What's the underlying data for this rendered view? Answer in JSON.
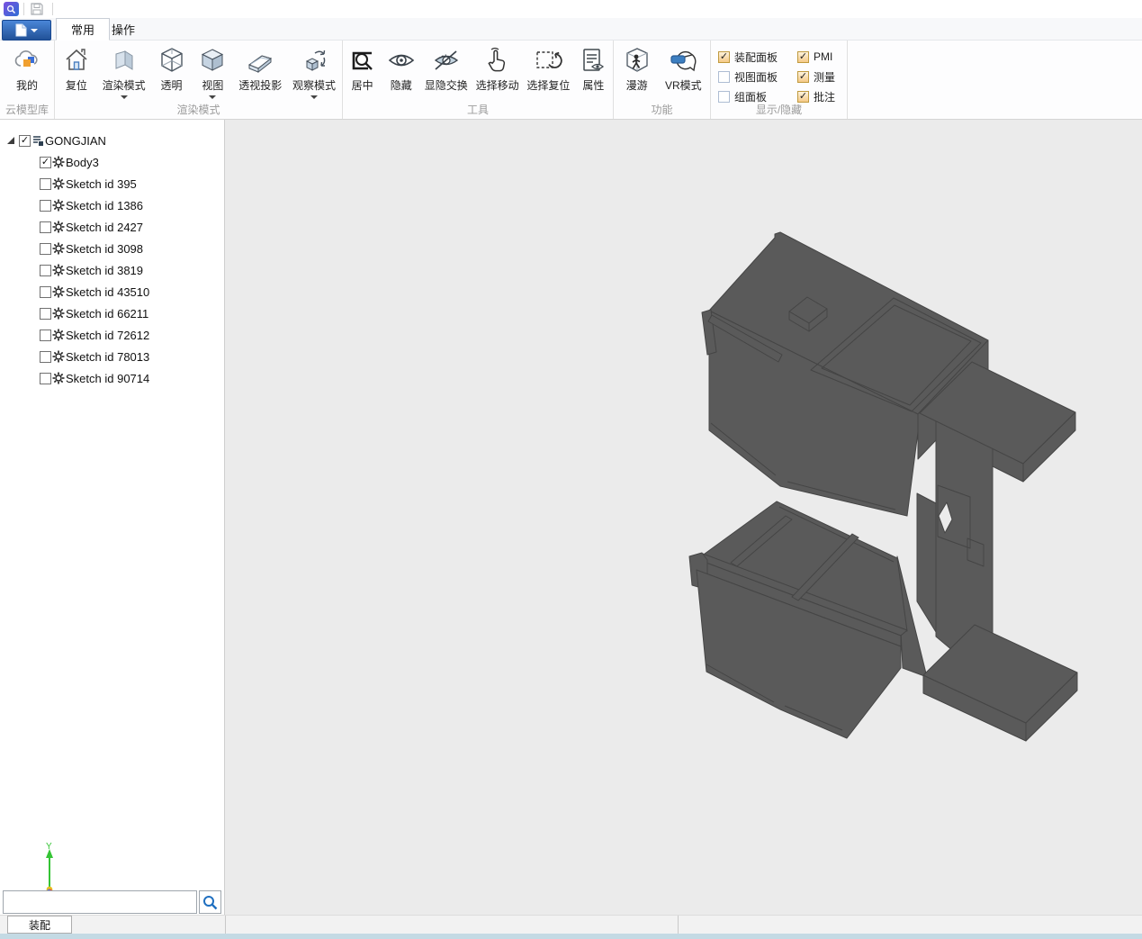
{
  "titlebar": {
    "app_icon": "magnifier-app-icon",
    "save_icon": "save-icon"
  },
  "tabs": {
    "file_button": "file-menu",
    "items": [
      {
        "label": "常用",
        "active": true
      },
      {
        "label": "操作",
        "active": false
      }
    ]
  },
  "ribbon": {
    "groups": [
      {
        "label": "云模型库",
        "buttons": [
          {
            "label": "我的",
            "icon": "cloud-cube"
          }
        ]
      },
      {
        "label": "渲染模式",
        "buttons": [
          {
            "label": "复位",
            "icon": "home"
          },
          {
            "label": "渲染模式",
            "icon": "shaded-face",
            "dropdown": true
          },
          {
            "label": "透明",
            "icon": "wireframe-cube"
          },
          {
            "label": "视图",
            "icon": "solid-cube",
            "dropdown": true
          },
          {
            "label": "透视投影",
            "icon": "perspective-box"
          },
          {
            "label": "观察模式",
            "icon": "orbit-cube",
            "dropdown": true
          }
        ]
      },
      {
        "label": "工具",
        "buttons": [
          {
            "label": "居中",
            "icon": "zoom-fit"
          },
          {
            "label": "隐藏",
            "icon": "eye"
          },
          {
            "label": "显隐交换",
            "icon": "eye-swap"
          },
          {
            "label": "选择移动",
            "icon": "hand-select"
          },
          {
            "label": "选择复位",
            "icon": "selection-reset"
          },
          {
            "label": "属性",
            "icon": "properties-doc"
          }
        ]
      },
      {
        "label": "功能",
        "buttons": [
          {
            "label": "漫游",
            "icon": "walk-cube"
          },
          {
            "label": "VR模式",
            "icon": "vr-headset"
          }
        ]
      },
      {
        "label": "显示/隐藏",
        "checkboxes": [
          {
            "label": "装配面板",
            "checked": true
          },
          {
            "label": "PMI",
            "checked": true
          },
          {
            "label": "视图面板",
            "checked": false
          },
          {
            "label": "测量",
            "checked": true
          },
          {
            "label": "组面板",
            "checked": false
          },
          {
            "label": "批注",
            "checked": true
          }
        ]
      }
    ]
  },
  "tree": {
    "root": {
      "label": "GONGJIAN",
      "checked": true,
      "expanded": true
    },
    "children": [
      {
        "label": "Body3",
        "checked": true
      },
      {
        "label": "Sketch id 395",
        "checked": false
      },
      {
        "label": "Sketch id 1386",
        "checked": false
      },
      {
        "label": "Sketch id 2427",
        "checked": false
      },
      {
        "label": "Sketch id 3098",
        "checked": false
      },
      {
        "label": "Sketch id 3819",
        "checked": false
      },
      {
        "label": "Sketch id 43510",
        "checked": false
      },
      {
        "label": "Sketch id 66211",
        "checked": false
      },
      {
        "label": "Sketch id 72612",
        "checked": false
      },
      {
        "label": "Sketch id 78013",
        "checked": false
      },
      {
        "label": "Sketch id 90714",
        "checked": false
      }
    ]
  },
  "panel": {
    "search_value": "",
    "bottom_tab": "装配"
  },
  "gizmo": {
    "y_label": "Y",
    "y_color": "#35c435",
    "x_color": "#e05050",
    "z_color": "#5b6fe0",
    "origin_color": "#e8c020"
  },
  "viewport": {
    "background": "#ebebeb",
    "model_fill": "#5a5a5a",
    "model_edge": "#454545",
    "hole_fill": "#ebebeb"
  }
}
